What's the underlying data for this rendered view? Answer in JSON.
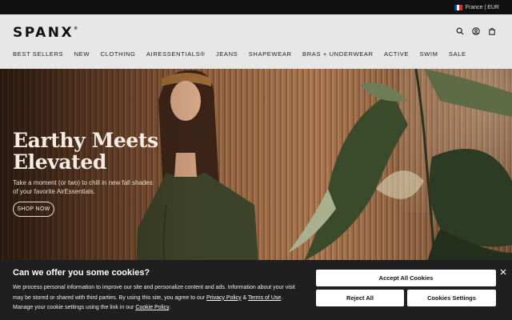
{
  "topbar": {
    "locale_label": "France | EUR",
    "flag_colors": [
      "#1f3d9a",
      "#ffffff",
      "#d92b2b"
    ]
  },
  "header": {
    "logo": "SPANX",
    "logo_mark": "®",
    "icons": [
      "search-icon",
      "account-icon",
      "bag-icon"
    ]
  },
  "nav": [
    "BEST SELLERS",
    "NEW",
    "CLOTHING",
    "AIRESSENTIALS®",
    "JEANS",
    "SHAPEWEAR",
    "BRAS + UNDERWEAR",
    "ACTIVE",
    "SWIM",
    "SALE"
  ],
  "hero": {
    "title_line1": "Earthy Meets",
    "title_line2": "Elevated",
    "subtitle": "Take a moment (or two) to chill in new fall shades of your favorite AirEssentials.",
    "cta": "SHOP NOW"
  },
  "cookie": {
    "title": "Can we offer you some cookies?",
    "text_1": "We process personal information to improve our site and personalize content and ads. Information about your visit may be stored or shared with third parties. By using this site, you agree to our ",
    "privacy_link": "Privacy Policy",
    "text_2": " & ",
    "terms_link": "Terms of Use",
    "text_3": ". Manage your cookie settings using the link in our ",
    "cookie_link": "Cookie Policy",
    "text_4": ".",
    "accept_all": "Accept All Cookies",
    "reject_all": "Reject All",
    "settings": "Cookies Settings"
  }
}
